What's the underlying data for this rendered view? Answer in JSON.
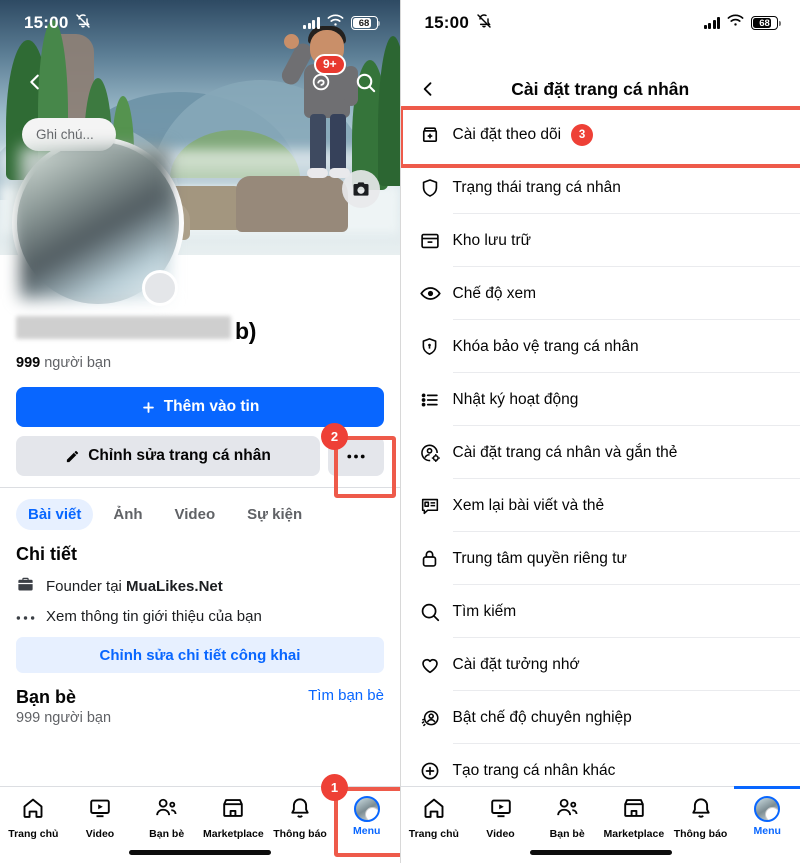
{
  "left": {
    "status_bar": {
      "time": "15:00",
      "mute_icon": "bell-slash-icon",
      "battery": "68"
    },
    "cover": {
      "back_icon": "back-chevron-icon",
      "threads_icon": "threads-icon",
      "threads_badge": "9+",
      "search_icon": "search-icon",
      "camera_icon": "camera-icon",
      "note_placeholder": "Ghi chú..."
    },
    "profile": {
      "name_suffix": "b)",
      "friends_count": "999",
      "friends_label": "người bạn",
      "add_story_button": "Thêm vào tin",
      "edit_profile_button": "Chỉnh sửa trang cá nhân",
      "more_button": "•••"
    },
    "tabs": [
      {
        "label": "Bài viết",
        "active": true
      },
      {
        "label": "Ảnh",
        "active": false
      },
      {
        "label": "Video",
        "active": false
      },
      {
        "label": "Sự kiện",
        "active": false
      }
    ],
    "details": {
      "title": "Chi tiết",
      "work_prefix": "Founder tại ",
      "work_place": "MuaLikes.Net",
      "about_link": "Xem thông tin giới thiệu của bạn",
      "edit_public_button": "Chỉnh sửa chi tiết công khai"
    },
    "friends_section": {
      "title": "Bạn bè",
      "subtitle": "999 người bạn",
      "find_friends_link": "Tìm bạn bè"
    },
    "bottom_nav": [
      {
        "label": "Trang chủ",
        "icon": "home-icon",
        "active": false
      },
      {
        "label": "Video",
        "icon": "video-icon",
        "active": false
      },
      {
        "label": "Bạn bè",
        "icon": "friends-icon",
        "active": false
      },
      {
        "label": "Marketplace",
        "icon": "marketplace-icon",
        "active": false
      },
      {
        "label": "Thông báo",
        "icon": "bell-icon",
        "active": false
      },
      {
        "label": "Menu",
        "icon": "menu-avatar-icon",
        "active": true
      }
    ]
  },
  "right": {
    "status_bar": {
      "time": "15:00",
      "mute_icon": "bell-slash-icon",
      "battery": "68"
    },
    "header": {
      "back_icon": "back-chevron-icon",
      "title": "Cài đặt trang cá nhân"
    },
    "menu_items": [
      {
        "label": "Cài đặt theo dõi",
        "icon": "follow-settings-icon",
        "badge": "3",
        "highlighted": true
      },
      {
        "label": "Trạng thái trang cá nhân",
        "icon": "shield-icon",
        "badge": "",
        "highlighted": false
      },
      {
        "label": "Kho lưu trữ",
        "icon": "archive-icon",
        "badge": "",
        "highlighted": false
      },
      {
        "label": "Chế độ xem",
        "icon": "eye-icon",
        "badge": "",
        "highlighted": false
      },
      {
        "label": "Khóa bảo vệ trang cá nhân",
        "icon": "shield-lock-icon",
        "badge": "",
        "highlighted": false
      },
      {
        "label": "Nhật ký hoạt động",
        "icon": "list-icon",
        "badge": "",
        "highlighted": false
      },
      {
        "label": "Cài đặt trang cá nhân và gắn thẻ",
        "icon": "profile-gear-icon",
        "badge": "",
        "highlighted": false
      },
      {
        "label": "Xem lại bài viết và thẻ",
        "icon": "review-posts-icon",
        "badge": "",
        "highlighted": false
      },
      {
        "label": "Trung tâm quyền riêng tư",
        "icon": "lock-icon",
        "badge": "",
        "highlighted": false
      },
      {
        "label": "Tìm kiếm",
        "icon": "search-icon",
        "badge": "",
        "highlighted": false
      },
      {
        "label": "Cài đặt tưởng nhớ",
        "icon": "heart-icon",
        "badge": "",
        "highlighted": false
      },
      {
        "label": "Bật chế độ chuyên nghiệp",
        "icon": "professional-mode-icon",
        "badge": "",
        "highlighted": false
      },
      {
        "label": "Tạo trang cá nhân khác",
        "icon": "plus-circle-icon",
        "badge": "",
        "highlighted": false
      }
    ],
    "bottom_nav": [
      {
        "label": "Trang chủ",
        "icon": "home-icon",
        "active": false
      },
      {
        "label": "Video",
        "icon": "video-icon",
        "active": false
      },
      {
        "label": "Bạn bè",
        "icon": "friends-icon",
        "active": false
      },
      {
        "label": "Marketplace",
        "icon": "marketplace-icon",
        "active": false
      },
      {
        "label": "Thông báo",
        "icon": "bell-icon",
        "active": false
      },
      {
        "label": "Menu",
        "icon": "menu-avatar-icon",
        "active": true
      }
    ]
  },
  "annotations": [
    {
      "number": "1",
      "target": "menu-tab-left"
    },
    {
      "number": "2",
      "target": "more-options-button"
    },
    {
      "number": "3",
      "target": "follow-settings-row"
    }
  ],
  "colors": {
    "accent": "#0866ff",
    "annotation": "#ee4036",
    "annotation_box": "#ee5a4a",
    "secondary_button": "#e4e6eb",
    "tab_active_bg": "#e7f0ff"
  }
}
